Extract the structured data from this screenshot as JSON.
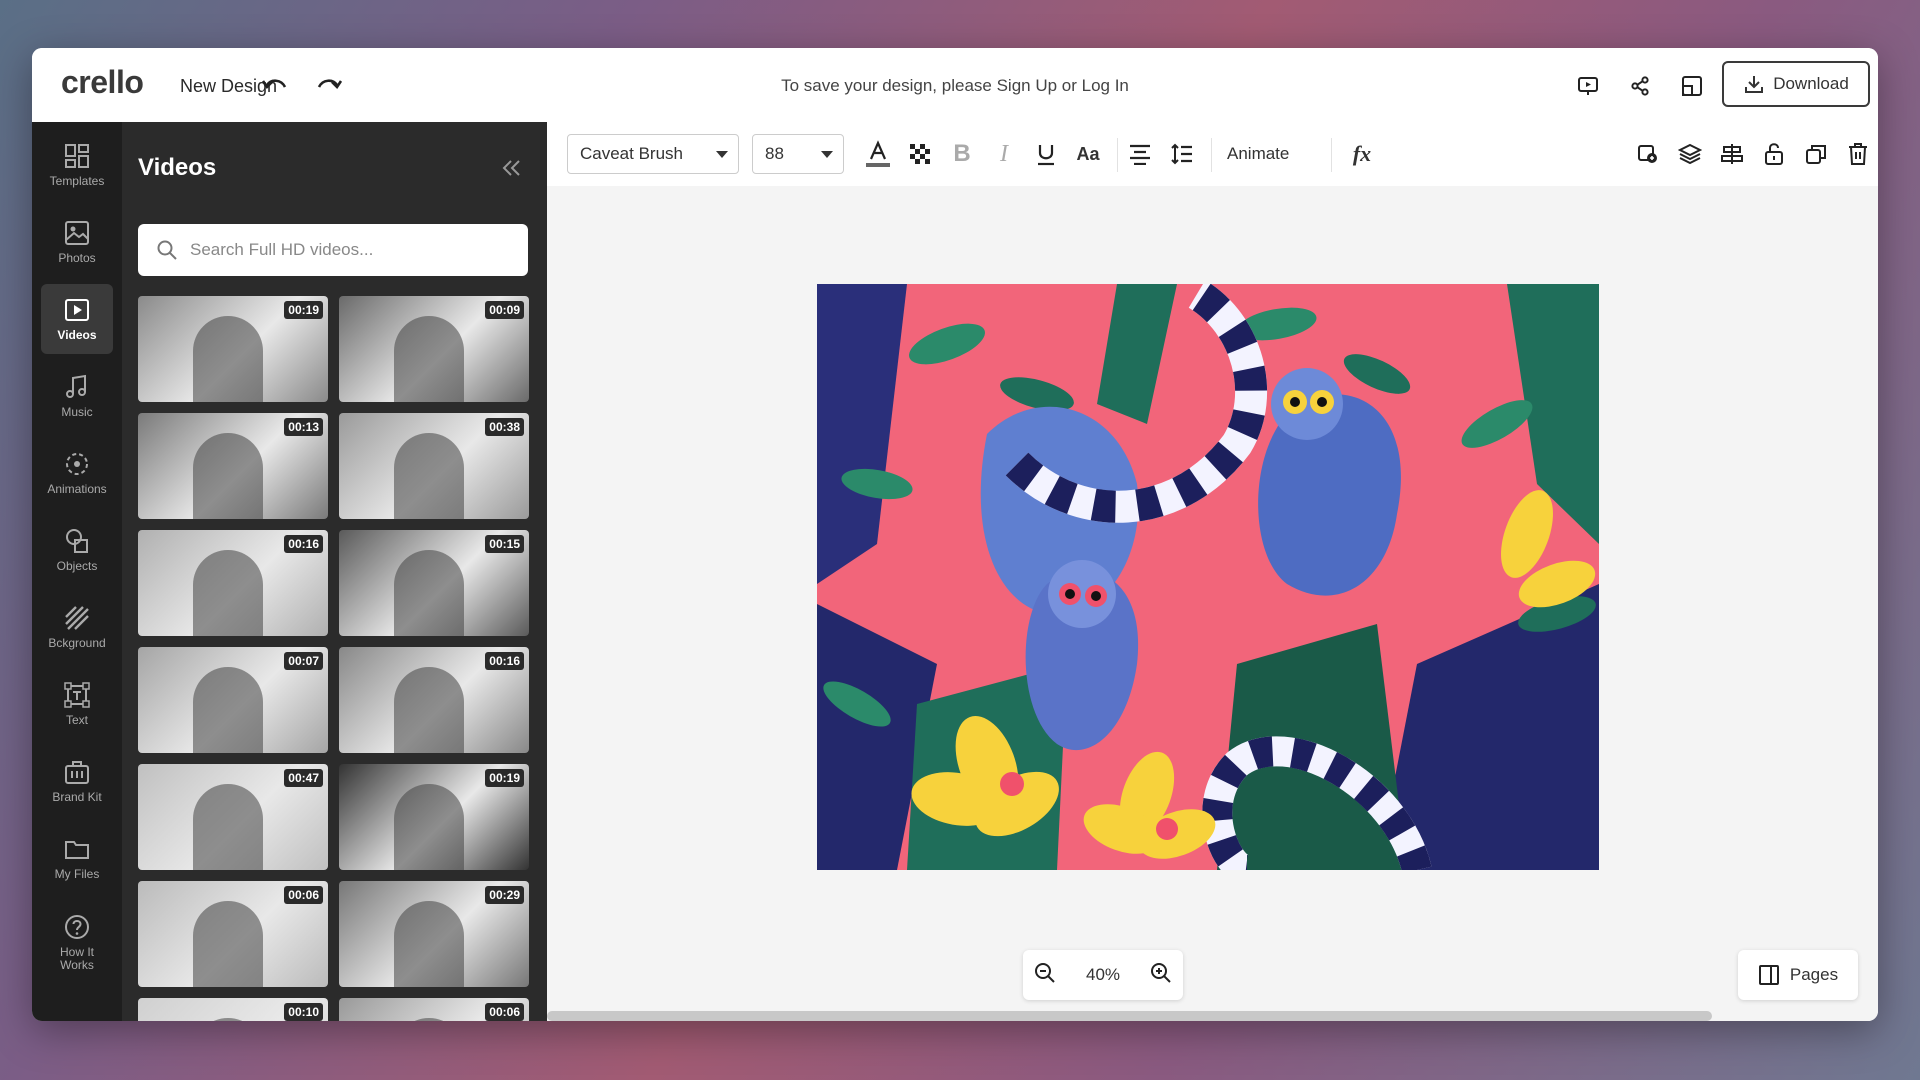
{
  "header": {
    "logo": "crello",
    "design_title": "New Design",
    "save_message_prefix": "To save your design, please ",
    "sign_up_label": "Sign Up",
    "or_label": " or ",
    "log_in_label": "Log In",
    "download_label": "Download"
  },
  "rail": {
    "items": [
      {
        "label": "Templates",
        "icon": "templates-icon"
      },
      {
        "label": "Photos",
        "icon": "photos-icon"
      },
      {
        "label": "Videos",
        "icon": "videos-icon"
      },
      {
        "label": "Music",
        "icon": "music-icon"
      },
      {
        "label": "Animations",
        "icon": "animations-icon"
      },
      {
        "label": "Objects",
        "icon": "objects-icon"
      },
      {
        "label": "Bckground",
        "icon": "background-icon"
      },
      {
        "label": "Text",
        "icon": "text-icon"
      },
      {
        "label": "Brand Kit",
        "icon": "brand-kit-icon"
      },
      {
        "label": "My Files",
        "icon": "my-files-icon"
      },
      {
        "label": "How It Works",
        "icon": "help-icon"
      }
    ]
  },
  "panel": {
    "title": "Videos",
    "search_placeholder": "Search Full HD videos...",
    "videos": [
      {
        "duration": "00:19"
      },
      {
        "duration": "00:09"
      },
      {
        "duration": "00:13"
      },
      {
        "duration": "00:38"
      },
      {
        "duration": "00:16"
      },
      {
        "duration": "00:15"
      },
      {
        "duration": "00:07"
      },
      {
        "duration": "00:16"
      },
      {
        "duration": "00:47"
      },
      {
        "duration": "00:19"
      },
      {
        "duration": "00:06"
      },
      {
        "duration": "00:29"
      },
      {
        "duration": "00:10"
      },
      {
        "duration": "00:06"
      }
    ]
  },
  "toolbar": {
    "font_family": "Caveat Brush",
    "font_size": "88",
    "animate_label": "Animate"
  },
  "canvas": {
    "zoom": "40%",
    "pages_label": "Pages"
  },
  "colors": {
    "rail_bg": "#1e1e1e",
    "panel_bg": "#2b2b2b",
    "workspace_bg": "#f4f4f4",
    "art_pink": "#f0516b",
    "art_navy": "#2a2f7a",
    "art_green": "#1f6e5a",
    "art_yellow": "#f7d23c"
  }
}
